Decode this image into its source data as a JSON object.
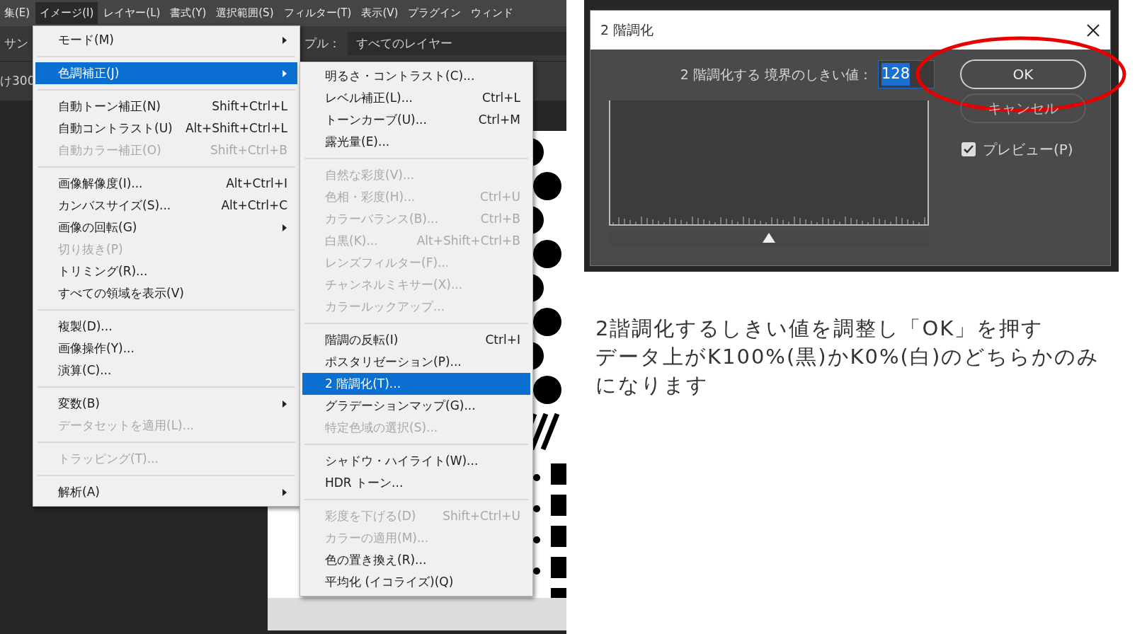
{
  "menu_bar": [
    {
      "label": "集(E)",
      "selected": false
    },
    {
      "label": "イメージ(I)",
      "selected": true
    },
    {
      "label": "レイヤー(L)",
      "selected": false
    },
    {
      "label": "書式(Y)",
      "selected": false
    },
    {
      "label": "選択範囲(S)",
      "selected": false
    },
    {
      "label": "フィルター(T)",
      "selected": false
    },
    {
      "label": "表示(V)",
      "selected": false
    },
    {
      "label": "プラグイン",
      "selected": false
    },
    {
      "label": "ウィンド",
      "selected": false
    }
  ],
  "options_bar": {
    "sample_label": "サン",
    "layers_label": "プル：",
    "layers_value": "すべてのレイヤー",
    "size_text": "け300"
  },
  "image_menu": [
    [
      {
        "label": "モード(M)",
        "submenu": true,
        "disabled": false,
        "selected": false
      }
    ],
    [
      {
        "label": "色調補正(J)",
        "submenu": true,
        "disabled": false,
        "selected": true
      }
    ],
    [
      {
        "label": "自動トーン補正(N)",
        "shortcut": "Shift+Ctrl+L",
        "submenu": false,
        "disabled": false,
        "selected": false
      },
      {
        "label": "自動コントラスト(U)",
        "shortcut": "Alt+Shift+Ctrl+L",
        "submenu": false,
        "disabled": false,
        "selected": false
      },
      {
        "label": "自動カラー補正(O)",
        "shortcut": "Shift+Ctrl+B",
        "submenu": false,
        "disabled": true,
        "selected": false
      }
    ],
    [
      {
        "label": "画像解像度(I)...",
        "shortcut": "Alt+Ctrl+I",
        "submenu": false,
        "disabled": false,
        "selected": false
      },
      {
        "label": "カンバスサイズ(S)...",
        "shortcut": "Alt+Ctrl+C",
        "submenu": false,
        "disabled": false,
        "selected": false
      },
      {
        "label": "画像の回転(G)",
        "submenu": true,
        "disabled": false,
        "selected": false
      },
      {
        "label": "切り抜き(P)",
        "submenu": false,
        "disabled": true,
        "selected": false
      },
      {
        "label": "トリミング(R)...",
        "submenu": false,
        "disabled": false,
        "selected": false
      },
      {
        "label": "すべての領域を表示(V)",
        "submenu": false,
        "disabled": false,
        "selected": false
      }
    ],
    [
      {
        "label": "複製(D)...",
        "submenu": false,
        "disabled": false,
        "selected": false
      },
      {
        "label": "画像操作(Y)...",
        "submenu": false,
        "disabled": false,
        "selected": false
      },
      {
        "label": "演算(C)...",
        "submenu": false,
        "disabled": false,
        "selected": false
      }
    ],
    [
      {
        "label": "変数(B)",
        "submenu": true,
        "disabled": false,
        "selected": false
      },
      {
        "label": "データセットを適用(L)...",
        "submenu": false,
        "disabled": true,
        "selected": false
      }
    ],
    [
      {
        "label": "トラッピング(T)...",
        "submenu": false,
        "disabled": true,
        "selected": false
      }
    ],
    [
      {
        "label": "解析(A)",
        "submenu": true,
        "disabled": false,
        "selected": false
      }
    ]
  ],
  "adjustments_menu": [
    [
      {
        "label": "明るさ・コントラスト(C)...",
        "disabled": false,
        "selected": false
      },
      {
        "label": "レベル補正(L)...",
        "shortcut": "Ctrl+L",
        "disabled": false,
        "selected": false
      },
      {
        "label": "トーンカーブ(U)...",
        "shortcut": "Ctrl+M",
        "disabled": false,
        "selected": false
      },
      {
        "label": "露光量(E)...",
        "disabled": false,
        "selected": false
      }
    ],
    [
      {
        "label": "自然な彩度(V)...",
        "disabled": true,
        "selected": false
      },
      {
        "label": "色相・彩度(H)...",
        "shortcut": "Ctrl+U",
        "disabled": true,
        "selected": false
      },
      {
        "label": "カラーバランス(B)...",
        "shortcut": "Ctrl+B",
        "disabled": true,
        "selected": false
      },
      {
        "label": "白黒(K)...",
        "shortcut": "Alt+Shift+Ctrl+B",
        "disabled": true,
        "selected": false
      },
      {
        "label": "レンズフィルター(F)...",
        "disabled": true,
        "selected": false
      },
      {
        "label": "チャンネルミキサー(X)...",
        "disabled": true,
        "selected": false
      },
      {
        "label": "カラールックアップ...",
        "disabled": true,
        "selected": false
      }
    ],
    [
      {
        "label": "階調の反転(I)",
        "shortcut": "Ctrl+I",
        "disabled": false,
        "selected": false
      },
      {
        "label": "ポスタリゼーション(P)...",
        "disabled": false,
        "selected": false
      },
      {
        "label": "2 階調化(T)...",
        "disabled": false,
        "selected": true
      },
      {
        "label": "グラデーションマップ(G)...",
        "disabled": false,
        "selected": false
      },
      {
        "label": "特定色域の選択(S)...",
        "disabled": true,
        "selected": false
      }
    ],
    [
      {
        "label": "シャドウ・ハイライト(W)...",
        "disabled": false,
        "selected": false
      },
      {
        "label": "HDR トーン...",
        "disabled": false,
        "selected": false
      }
    ],
    [
      {
        "label": "彩度を下げる(D)",
        "shortcut": "Shift+Ctrl+U",
        "disabled": true,
        "selected": false
      },
      {
        "label": "カラーの適用(M)...",
        "disabled": true,
        "selected": false
      },
      {
        "label": "色の置き換え(R)...",
        "disabled": false,
        "selected": false
      },
      {
        "label": "平均化 (イコライズ)(Q)",
        "disabled": false,
        "selected": false
      }
    ]
  ],
  "dialog": {
    "title": "2 階調化",
    "threshold_label": "2 階調化する 境界のしきい値：",
    "threshold_value": "128",
    "value_highlighted": true,
    "threshold_slider": {
      "level": 0.5
    },
    "buttons": [
      {
        "label": "OK",
        "circled": true
      },
      {
        "label": "キャンセル",
        "circled": false
      }
    ],
    "preview": {
      "label": "プレビュー(P)",
      "checked": true
    }
  },
  "caption": [
    "2諧調化するしきい値を調整し「OK」を押す",
    "データ上がK100%(黒)かK0%(白)のどちらかのみになります"
  ]
}
